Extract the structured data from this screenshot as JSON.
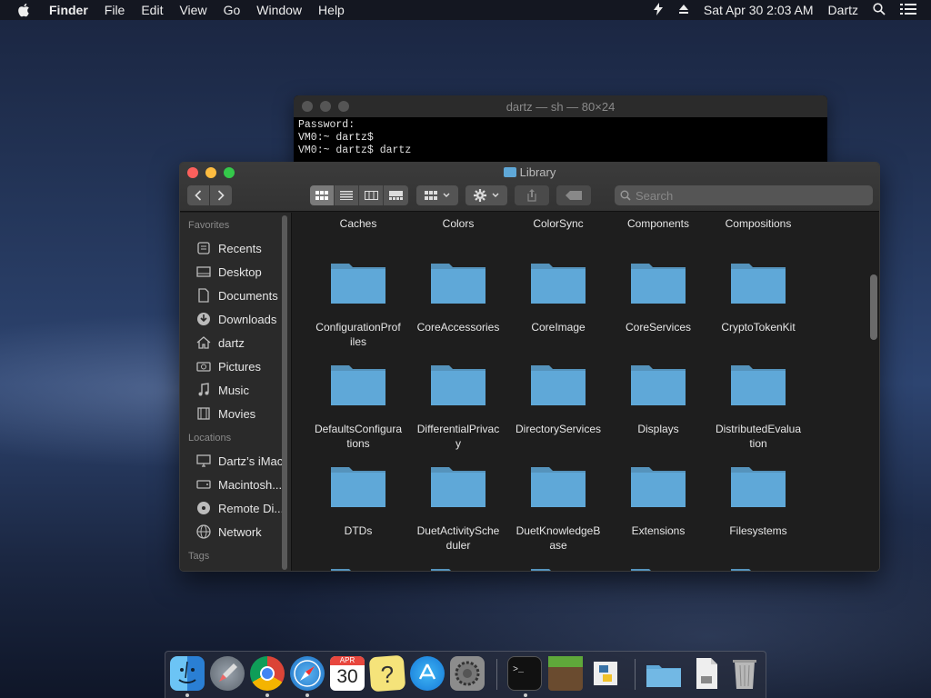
{
  "menubar": {
    "app_name": "Finder",
    "menus": [
      "File",
      "Edit",
      "View",
      "Go",
      "Window",
      "Help"
    ],
    "clock": "Sat Apr 30  2:03 AM",
    "user": "Dartz"
  },
  "terminal": {
    "title": "dartz — sh — 80×24",
    "lines": [
      "Password:",
      "VM0:~ dartz$",
      "VM0:~ dartz$ dartz"
    ]
  },
  "finder": {
    "title": "Library",
    "search_placeholder": "Search",
    "sidebar": {
      "favorites_header": "Favorites",
      "favorites": [
        {
          "label": "Recents",
          "icon": "recents-icon"
        },
        {
          "label": "Desktop",
          "icon": "desktop-icon"
        },
        {
          "label": "Documents",
          "icon": "documents-icon"
        },
        {
          "label": "Downloads",
          "icon": "downloads-icon"
        },
        {
          "label": "dartz",
          "icon": "home-icon"
        },
        {
          "label": "Pictures",
          "icon": "pictures-icon"
        },
        {
          "label": "Music",
          "icon": "music-icon"
        },
        {
          "label": "Movies",
          "icon": "movies-icon"
        }
      ],
      "locations_header": "Locations",
      "locations": [
        {
          "label": "Dartz’s iMac",
          "icon": "imac-icon"
        },
        {
          "label": "Macintosh...",
          "icon": "disk-icon"
        },
        {
          "label": "Remote Di...",
          "icon": "remote-disc-icon"
        },
        {
          "label": "Network",
          "icon": "network-icon"
        }
      ],
      "tags_header": "Tags"
    },
    "top_row": [
      "Caches",
      "Colors",
      "ColorSync",
      "Components",
      "Compositions"
    ],
    "folder_rows": [
      [
        {
          "l1": "ConfigurationProf",
          "l2": "iles"
        },
        {
          "l1": "CoreAccessories",
          "l2": ""
        },
        {
          "l1": "CoreImage",
          "l2": ""
        },
        {
          "l1": "CoreServices",
          "l2": ""
        },
        {
          "l1": "CryptoTokenKit",
          "l2": ""
        }
      ],
      [
        {
          "l1": "DefaultsConfigura",
          "l2": "tions"
        },
        {
          "l1": "DifferentialPrivac",
          "l2": "y"
        },
        {
          "l1": "DirectoryServices",
          "l2": ""
        },
        {
          "l1": "Displays",
          "l2": ""
        },
        {
          "l1": "DistributedEvalua",
          "l2": "tion"
        }
      ],
      [
        {
          "l1": "DTDs",
          "l2": ""
        },
        {
          "l1": "DuetActivitySche",
          "l2": "duler"
        },
        {
          "l1": "DuetKnowledgeB",
          "l2": "ase"
        },
        {
          "l1": "Extensions",
          "l2": ""
        },
        {
          "l1": "Filesystems",
          "l2": ""
        }
      ]
    ],
    "folder_color": "#5fa8d8"
  },
  "dock": {
    "calendar_month": "APR",
    "calendar_day": "30",
    "apps": [
      "finder",
      "launchpad",
      "chrome",
      "safari",
      "calendar",
      "help",
      "app-store",
      "system-preferences",
      "terminal",
      "minecraft",
      "python",
      "folder",
      "file",
      "trash"
    ]
  }
}
